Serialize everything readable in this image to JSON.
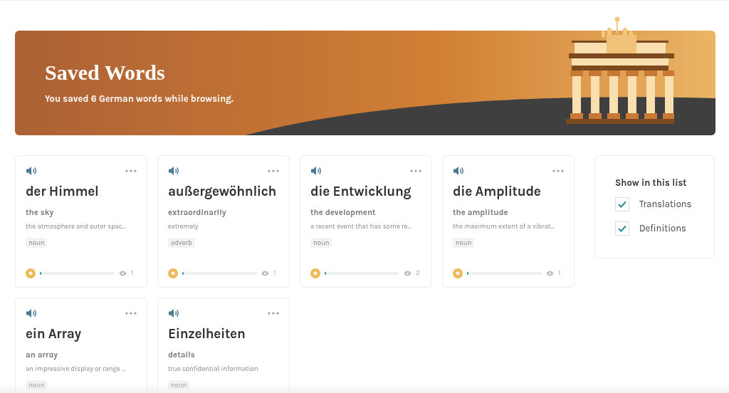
{
  "banner": {
    "title": "Saved Words",
    "subtitle": "You saved 6 German words while browsing."
  },
  "words": [
    {
      "word": "der Himmel",
      "translation": "the sky",
      "definition": "the atmosphere and outer spac...",
      "part_of_speech": "noun",
      "level": 0.01,
      "views": "1"
    },
    {
      "word": "außergewöhnlich",
      "translation": "extraordinarily",
      "definition": "extremely",
      "part_of_speech": "adverb",
      "level": 0.01,
      "views": "1"
    },
    {
      "word": "die Entwicklung",
      "translation": "the development",
      "definition": "a recent event that has some re...",
      "part_of_speech": "noun",
      "level": 0.02,
      "views": "2"
    },
    {
      "word": "die Amplitude",
      "translation": "the amplitude",
      "definition": "the maximum extent of a vibrat...",
      "part_of_speech": "noun",
      "level": 0.01,
      "views": "1"
    },
    {
      "word": "ein Array",
      "translation": "an array",
      "definition": "an impressive display or range ...",
      "part_of_speech": "noun"
    },
    {
      "word": "Einzelheiten",
      "translation": "details",
      "definition": "true confidential information",
      "part_of_speech": "noun"
    }
  ],
  "filter": {
    "title": "Show in this list",
    "options": [
      {
        "label": "Translations",
        "checked": true
      },
      {
        "label": "Definitions",
        "checked": true
      }
    ]
  }
}
